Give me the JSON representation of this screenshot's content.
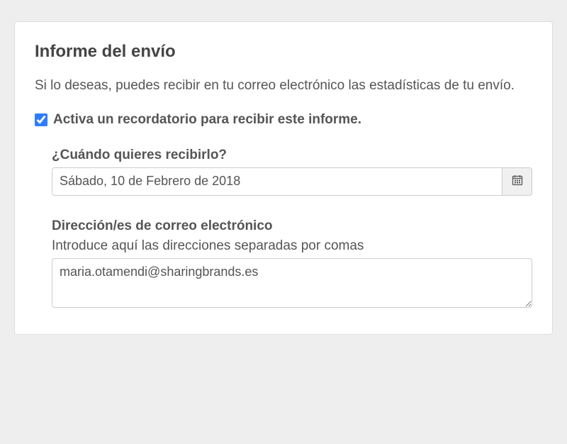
{
  "panel": {
    "title": "Informe del envío",
    "description": "Si lo deseas, puedes recibir en tu correo electrónico las estadísticas de tu envío.",
    "reminder": {
      "label": "Activa un recordatorio para recibir este informe.",
      "checked": true
    },
    "date": {
      "label": "¿Cuándo quieres recibirlo?",
      "value": "Sábado, 10 de Febrero de 2018"
    },
    "email": {
      "label": "Dirección/es de correo electrónico",
      "help": "Introduce aquí las direcciones separadas por comas",
      "value": "maria.otamendi@sharingbrands.es"
    }
  }
}
